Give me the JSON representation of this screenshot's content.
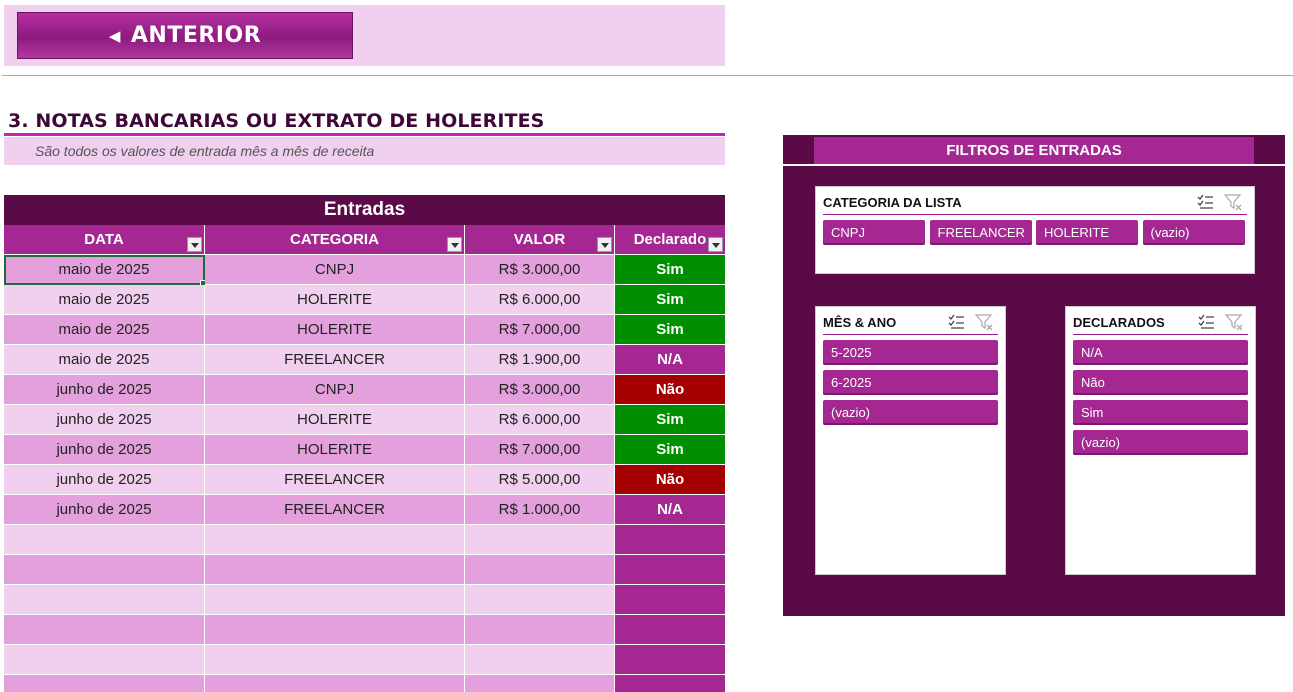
{
  "nav": {
    "prev_label": "ANTERIOR"
  },
  "section": {
    "title": "3. NOTAS BANCARIAS OU EXTRATO DE HOLERITES",
    "subtitle": "São todos os valores de entrada mês a mês de receita"
  },
  "table": {
    "caption": "Entradas",
    "headers": [
      "DATA",
      "CATEGORIA",
      "VALOR",
      "Declarado"
    ],
    "rows": [
      [
        "maio de 2025",
        "CNPJ",
        "R$ 3.000,00",
        "Sim"
      ],
      [
        "maio de 2025",
        "HOLERITE",
        "R$ 6.000,00",
        "Sim"
      ],
      [
        "maio de 2025",
        "HOLERITE",
        "R$ 7.000,00",
        "Sim"
      ],
      [
        "maio de 2025",
        "FREELANCER",
        "R$ 1.900,00",
        "N/A"
      ],
      [
        "junho de 2025",
        "CNPJ",
        "R$ 3.000,00",
        "Não"
      ],
      [
        "junho de 2025",
        "HOLERITE",
        "R$ 6.000,00",
        "Sim"
      ],
      [
        "junho de 2025",
        "HOLERITE",
        "R$ 7.000,00",
        "Sim"
      ],
      [
        "junho de 2025",
        "FREELANCER",
        "R$ 5.000,00",
        "Não"
      ],
      [
        "junho de 2025",
        "FREELANCER",
        "R$ 1.000,00",
        "N/A"
      ]
    ],
    "empty_rows": 6
  },
  "filters": {
    "title": "FILTROS DE ENTRADAS",
    "categoria": {
      "title": "CATEGORIA DA LISTA",
      "items": [
        "CNPJ",
        "FREELANCER",
        "HOLERITE",
        "(vazio)"
      ]
    },
    "mes_ano": {
      "title": "MÊS & ANO",
      "items": [
        "5-2025",
        "6-2025",
        "(vazio)"
      ]
    },
    "declarados": {
      "title": "DECLARADOS",
      "items": [
        "N/A",
        "Não",
        "Sim",
        "(vazio)"
      ]
    }
  },
  "colors": {
    "accent": "#a52792",
    "dark": "#5b0a48",
    "light": "#f1cfee",
    "mid": "#e4a0dc",
    "sim": "#008f00",
    "nao": "#a50000"
  },
  "icons": [
    "multi-select-icon",
    "clear-filter-icon"
  ]
}
